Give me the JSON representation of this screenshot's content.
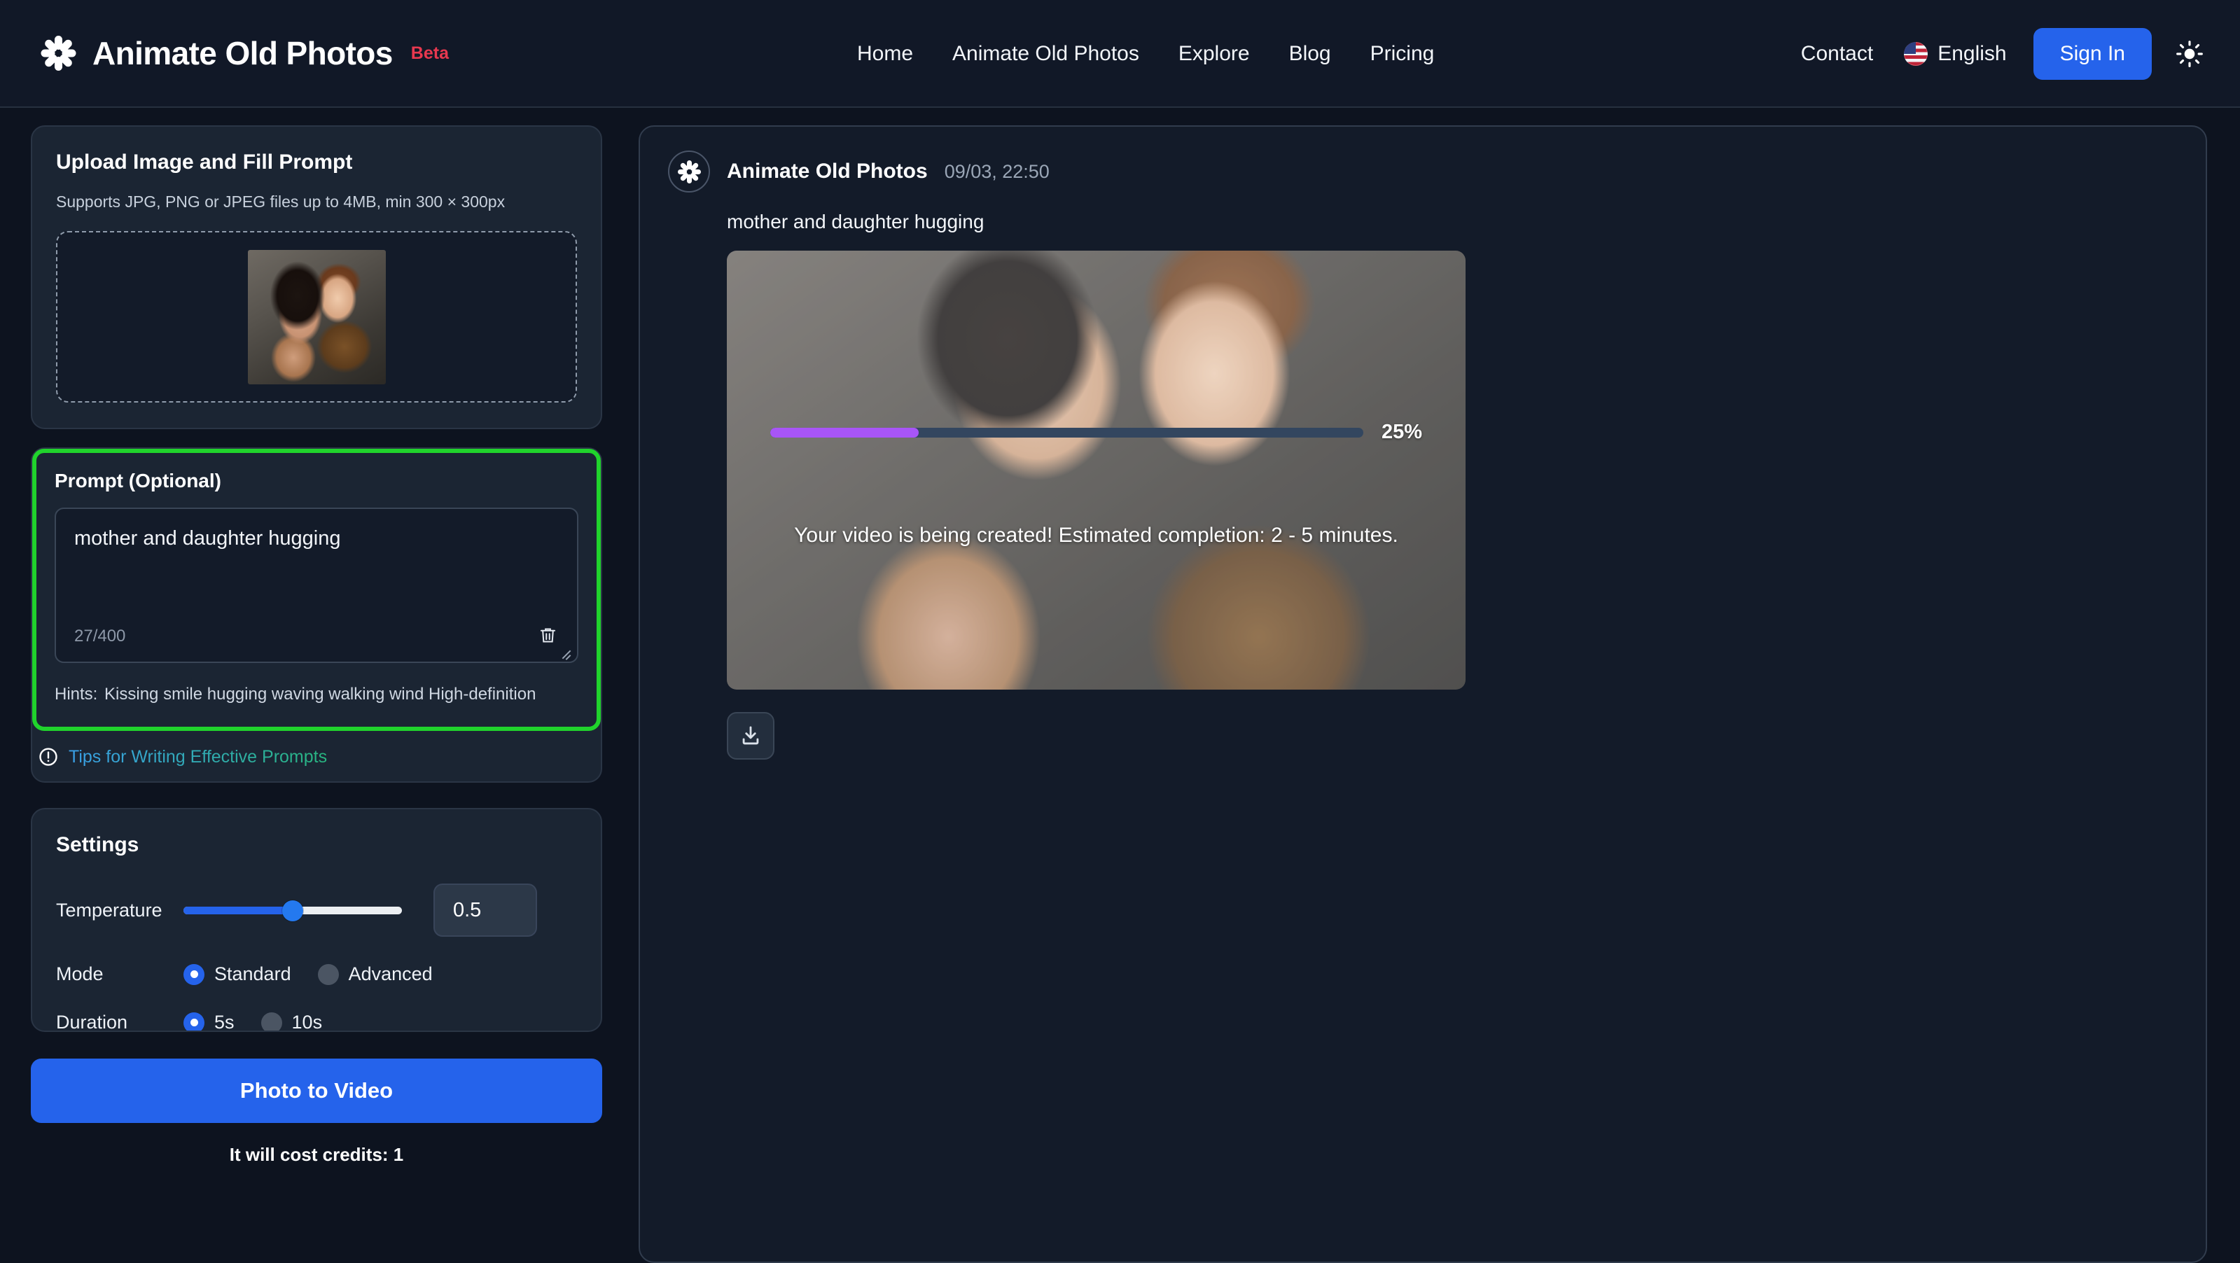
{
  "header": {
    "brand_title": "Animate Old Photos",
    "brand_badge": "Beta",
    "nav": [
      {
        "label": "Home"
      },
      {
        "label": "Animate Old Photos"
      },
      {
        "label": "Explore"
      },
      {
        "label": "Blog"
      },
      {
        "label": "Pricing"
      }
    ],
    "contact_label": "Contact",
    "language_label": "English",
    "language_flag": "us-flag-icon",
    "signin_label": "Sign In",
    "theme_toggle_icon": "sun-icon"
  },
  "upload": {
    "title": "Upload Image and Fill Prompt",
    "subtitle": "Supports JPG, PNG or JPEG files up to 4MB, min 300 × 300px",
    "dropzone_name": "image-dropzone"
  },
  "prompt": {
    "label": "Prompt (Optional)",
    "value": "mother and daughter hugging",
    "placeholder": "",
    "counter": "27/400",
    "clear_icon": "trash-icon",
    "hints_label": "Hints:",
    "hints": [
      "Kissing",
      "smile",
      "hugging",
      "waving",
      "walking",
      "wind",
      "High-definition"
    ],
    "tips_link": "Tips for Writing Effective Prompts",
    "tips_icon": "info-circle-icon"
  },
  "settings": {
    "title": "Settings",
    "temperature_label": "Temperature",
    "temperature_value": "0.5",
    "temperature_percent": 50,
    "mode_label": "Mode",
    "mode_options": [
      {
        "label": "Standard",
        "selected": true
      },
      {
        "label": "Advanced",
        "selected": false
      }
    ],
    "duration_label": "Duration",
    "duration_options": [
      {
        "label": "5s",
        "selected": true
      },
      {
        "label": "10s",
        "selected": false
      }
    ]
  },
  "action": {
    "cta_label": "Photo to Video",
    "cost_label": "It will cost credits: 1"
  },
  "result": {
    "author": "Animate Old Photos",
    "timestamp": "09/03, 22:50",
    "prompt_echo": "mother and daughter hugging",
    "progress_percent_label": "25%",
    "progress_percent": 25,
    "status_text": "Your video is being created! Estimated completion: 2 - 5 minutes.",
    "download_icon": "download-icon"
  },
  "colors": {
    "page_bg": "#0d131f",
    "card_bg": "#1b2533",
    "accent_blue": "#2563eb",
    "highlight_green": "#20d32c",
    "progress_purple": "#a855f7",
    "beta_red": "#e8384f"
  }
}
